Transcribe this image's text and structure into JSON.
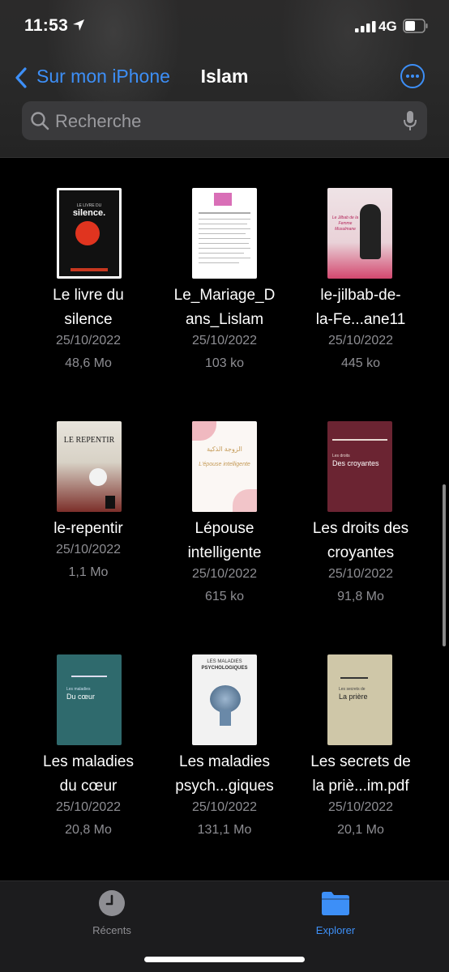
{
  "status": {
    "time": "11:53",
    "network": "4G"
  },
  "nav": {
    "back_label": "Sur mon iPhone",
    "title": "Islam"
  },
  "search": {
    "placeholder": "Recherche"
  },
  "files": [
    {
      "name_line1": "Le livre du",
      "name_line2": "silence",
      "date": "25/10/2022",
      "size": "48,6 Mo",
      "cover_text": "silence.",
      "cover_sub": "LE LIVRE DU"
    },
    {
      "name_line1": "Le_Mariage_D",
      "name_line2": "ans_Lislam",
      "date": "25/10/2022",
      "size": "103 ko",
      "cover_text": "",
      "cover_sub": ""
    },
    {
      "name_line1": "le-jilbab-de-",
      "name_line2": "la-Fe...ane11",
      "date": "25/10/2022",
      "size": "445 ko",
      "cover_text": "Le Jilbab de la Femme Musulmane",
      "cover_sub": ""
    },
    {
      "name_line1": "le-repentir",
      "name_line2": "",
      "date": "25/10/2022",
      "size": "1,1 Mo",
      "cover_text": "LE REPENTIR",
      "cover_sub": ""
    },
    {
      "name_line1": "Lépouse",
      "name_line2": "intelligente",
      "date": "25/10/2022",
      "size": "615 ko",
      "cover_text": "L'épouse intelligente",
      "cover_sub": "الزوجة الذكية"
    },
    {
      "name_line1": "Les droits des",
      "name_line2": "croyantes",
      "date": "25/10/2022",
      "size": "91,8 Mo",
      "cover_text": "Des croyantes",
      "cover_sub": "Les droits"
    },
    {
      "name_line1": "Les maladies",
      "name_line2": "du cœur",
      "date": "25/10/2022",
      "size": "20,8 Mo",
      "cover_text": "Du cœur",
      "cover_sub": "Les maladies"
    },
    {
      "name_line1": "Les maladies",
      "name_line2": "psych...giques",
      "date": "25/10/2022",
      "size": "131,1 Mo",
      "cover_text": "PSYCHOLOGIQUES",
      "cover_sub": "LES MALADIES"
    },
    {
      "name_line1": "Les secrets de",
      "name_line2": "la priè...im.pdf",
      "date": "25/10/2022",
      "size": "20,1 Mo",
      "cover_text": "La prière",
      "cover_sub": "Les secrets de"
    }
  ],
  "tabs": {
    "recents": "Récents",
    "browse": "Explorer"
  },
  "colors": {
    "accent": "#3d8ff7",
    "secondary_text": "#8e8e93",
    "tab_inactive": "#8e8e93"
  }
}
